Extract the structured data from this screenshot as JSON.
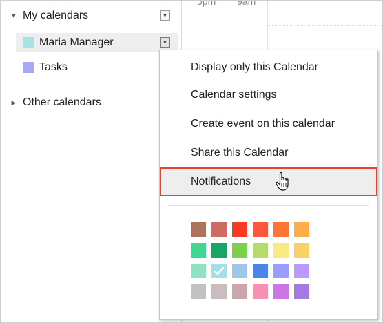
{
  "grid": {
    "time_labels": [
      "5pm",
      "9am"
    ]
  },
  "sidebar": {
    "my_calendars": {
      "label": "My calendars",
      "expanded": true,
      "items": [
        {
          "label": "Maria Manager",
          "color": "#a8e2e2",
          "active": true
        },
        {
          "label": "Tasks",
          "color": "#a8a8f6",
          "active": false
        }
      ]
    },
    "other_calendars": {
      "label": "Other calendars",
      "expanded": false
    }
  },
  "menu": {
    "items": [
      {
        "label": "Display only this Calendar"
      },
      {
        "label": "Calendar settings"
      },
      {
        "label": "Create event on this calendar"
      },
      {
        "label": "Share this Calendar"
      },
      {
        "label": "Notifications",
        "hovered": true
      }
    ],
    "highlight_color": "#e8412c",
    "palette": {
      "selected": {
        "row": 2,
        "col": 1
      },
      "rows": [
        [
          "#ac725e",
          "#d06b64",
          "#f83a22",
          "#fa573c",
          "#ff7537",
          "#ffad46"
        ],
        [
          "#42d692",
          "#16a765",
          "#7bd148",
          "#b3dc6c",
          "#fbe983",
          "#fad165"
        ],
        [
          "#92e1c0",
          "#9fe1e7",
          "#9fc6e7",
          "#4986e7",
          "#9a9cff",
          "#b99aff"
        ],
        [
          "#c2c2c2",
          "#cabdbf",
          "#cca6ac",
          "#f691b2",
          "#cd74e6",
          "#a47ae2"
        ]
      ]
    }
  }
}
